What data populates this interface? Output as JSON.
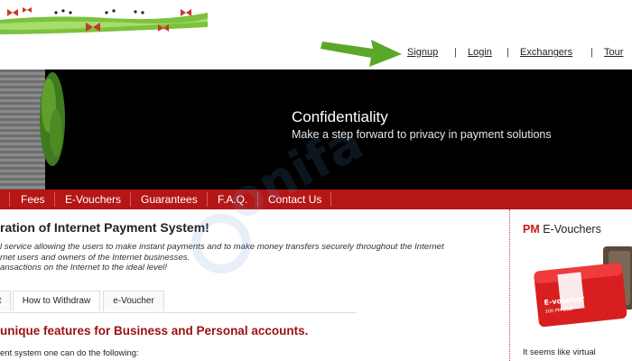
{
  "topnav": {
    "links": [
      "Signup",
      "Login",
      "Exchangers",
      "Tour"
    ],
    "separator": "|"
  },
  "banner": {
    "title": "Confidentiality",
    "subtitle": "Make a step forward to privacy in payment solutions"
  },
  "nav": {
    "items": [
      "Fees",
      "E-Vouchers",
      "Guarantees",
      "F.A.Q.",
      "Contact Us"
    ]
  },
  "main": {
    "title": "ration of Internet Payment System!",
    "intro_lines": [
      "l service allowing the users to make instant payments and to make money transfers securely throughout the Internet",
      "rnet users and owners of the Internet businesses.",
      "ansactions on the Internet to the ideal level!"
    ],
    "tabs": [
      "t",
      "How to Withdraw",
      "e-Voucher"
    ],
    "features_title": "unique features for Business and Personal accounts.",
    "features_sub": "ent system one can do the following:"
  },
  "sidebar": {
    "title_prefix": "PM",
    "title_rest": " E-Vouchers",
    "voucher_label": "E-voucher",
    "voucher_amount": "300 PM USD",
    "text": "It seems like virtual"
  },
  "colors": {
    "nav_red": "#b51616",
    "accent_red": "#c81a1a",
    "arrow_green": "#5aa82a"
  },
  "icons": {
    "arrow": "green-arrow-icon",
    "butterfly": "butterfly-icon"
  }
}
